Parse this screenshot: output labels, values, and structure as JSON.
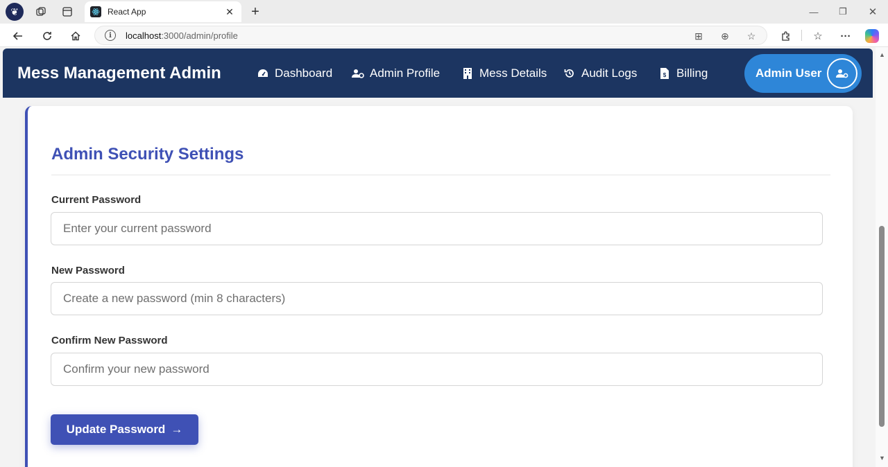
{
  "browser": {
    "tab_title": "React App",
    "tab_close": "✕",
    "new_tab": "+",
    "url_host": "localhost",
    "url_path": ":3000/admin/profile",
    "window_controls": {
      "minimize": "—",
      "maximize": "❐",
      "close": "✕"
    }
  },
  "navbar": {
    "brand": "Mess Management Admin",
    "items": [
      {
        "label": "Dashboard",
        "icon": "gauge-icon"
      },
      {
        "label": "Admin Profile",
        "icon": "user-gear-icon"
      },
      {
        "label": "Mess Details",
        "icon": "building-icon"
      },
      {
        "label": "Audit Logs",
        "icon": "history-icon"
      },
      {
        "label": "Billing",
        "icon": "invoice-icon"
      }
    ],
    "user": {
      "name": "Admin User"
    }
  },
  "security": {
    "title": "Admin Security Settings",
    "current_password": {
      "label": "Current Password",
      "placeholder": "Enter your current password",
      "value": ""
    },
    "new_password": {
      "label": "New Password",
      "placeholder": "Create a new password (min 8 characters)",
      "value": ""
    },
    "confirm_password": {
      "label": "Confirm New Password",
      "placeholder": "Confirm your new password",
      "value": ""
    },
    "submit": {
      "label": "Update Password",
      "arrow": "→"
    }
  },
  "colors": {
    "navbar_bg": "#1c3561",
    "accent": "#3f51b5",
    "user_pill": "#2e86d8"
  }
}
